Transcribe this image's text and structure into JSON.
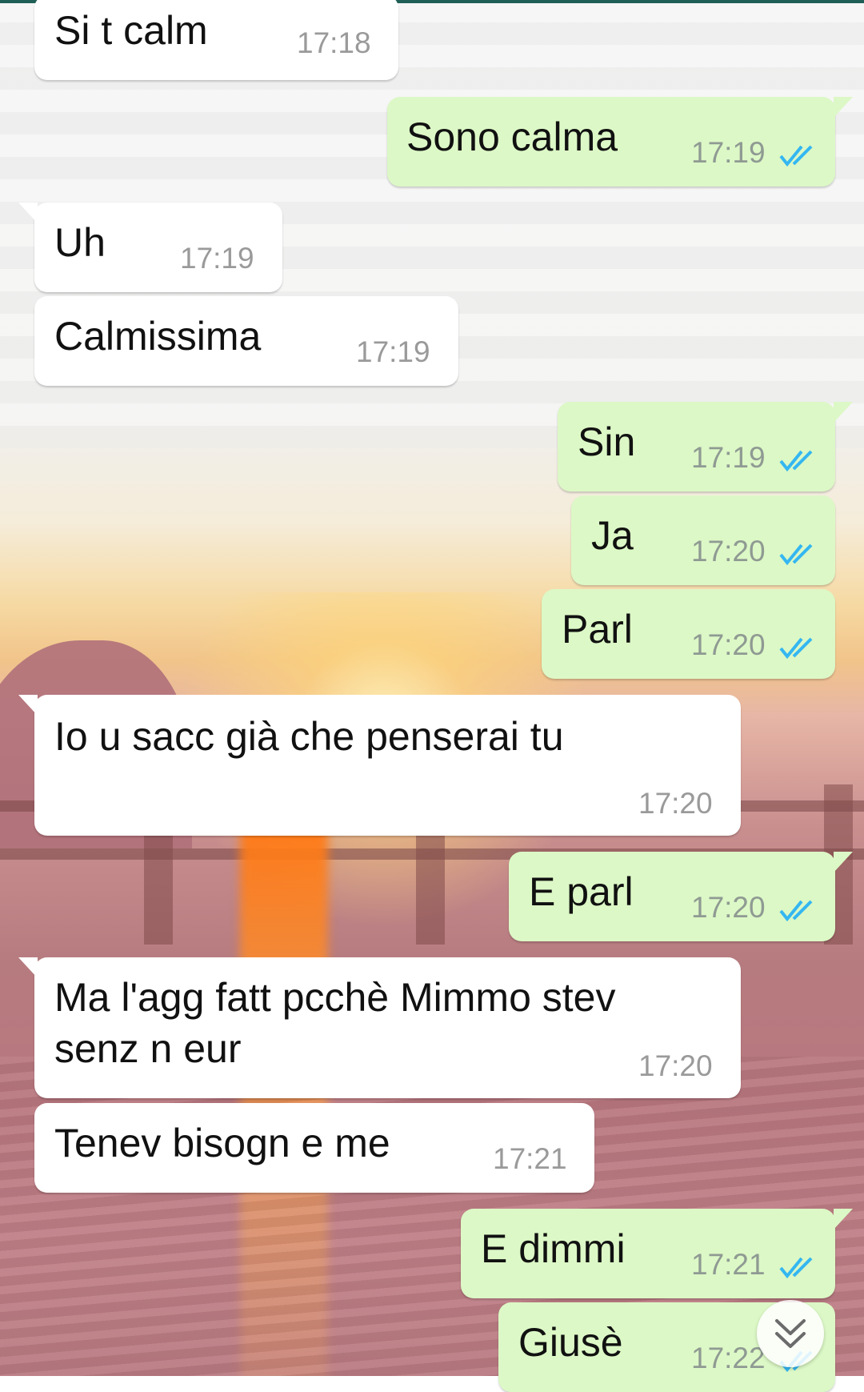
{
  "messages": [
    {
      "dir": "in",
      "text": "Si t calm",
      "time": "17:18"
    },
    {
      "dir": "out",
      "text": "Sono calma",
      "time": "17:19",
      "status": "read"
    },
    {
      "dir": "in",
      "text": "Uh",
      "time": "17:19"
    },
    {
      "dir": "in",
      "text": "Calmissima",
      "time": "17:19"
    },
    {
      "dir": "out",
      "text": "Sin",
      "time": "17:19",
      "status": "read"
    },
    {
      "dir": "out",
      "text": "Ja",
      "time": "17:20",
      "status": "read"
    },
    {
      "dir": "out",
      "text": "Parl",
      "time": "17:20",
      "status": "read"
    },
    {
      "dir": "in",
      "text": "Io u sacc già che penserai tu",
      "time": "17:20"
    },
    {
      "dir": "out",
      "text": "E parl",
      "time": "17:20",
      "status": "read"
    },
    {
      "dir": "in",
      "text_line1": "Ma l'agg fatt pcchè Mimmo stev",
      "text_line2": "senz n eur",
      "time": "17:20"
    },
    {
      "dir": "in",
      "text": "Tenev bisogn e me",
      "time": "17:21"
    },
    {
      "dir": "out",
      "text": "E dimmi",
      "time": "17:21",
      "status": "read"
    },
    {
      "dir": "out",
      "text": "Giusè",
      "time": "17:22",
      "status": "read"
    }
  ],
  "icons": {
    "read_ticks": "double-check-icon",
    "scroll_down": "double-chevron-down-icon"
  },
  "colors": {
    "incoming_bubble": "#ffffff",
    "outgoing_bubble": "#dcf8c6",
    "read_tick": "#34b7f1",
    "header_accent": "#1f5f57"
  }
}
